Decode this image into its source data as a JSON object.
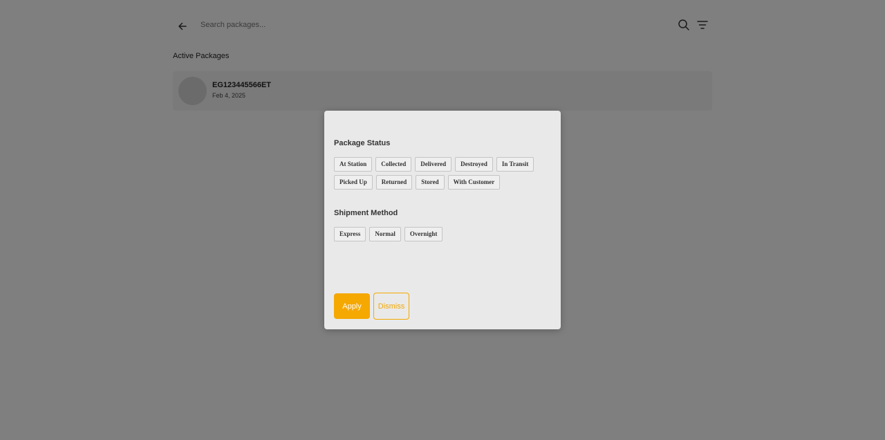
{
  "header": {
    "search_placeholder": "Search packages...",
    "back_icon": "arrow-left-icon",
    "search_icon": "search-icon",
    "filter_icon": "filter-icon"
  },
  "section_title": "Active Packages",
  "packages": [
    {
      "id": "EG123445566ET",
      "date": "Feb 4, 2025"
    }
  ],
  "filter_modal": {
    "status_title": "Package Status",
    "status_options": [
      "At Station",
      "Collected",
      "Delivered",
      "Destroyed",
      "In Transit",
      "Picked Up",
      "Returned",
      "Stored",
      "With Customer"
    ],
    "method_title": "Shipment Method",
    "method_options": [
      "Express",
      "Normal",
      "Overnight"
    ],
    "apply_label": "Apply",
    "dismiss_label": "Dismiss"
  },
  "colors": {
    "accent": "#f5a800",
    "overlay": "rgba(0,0,0,0.5)"
  }
}
